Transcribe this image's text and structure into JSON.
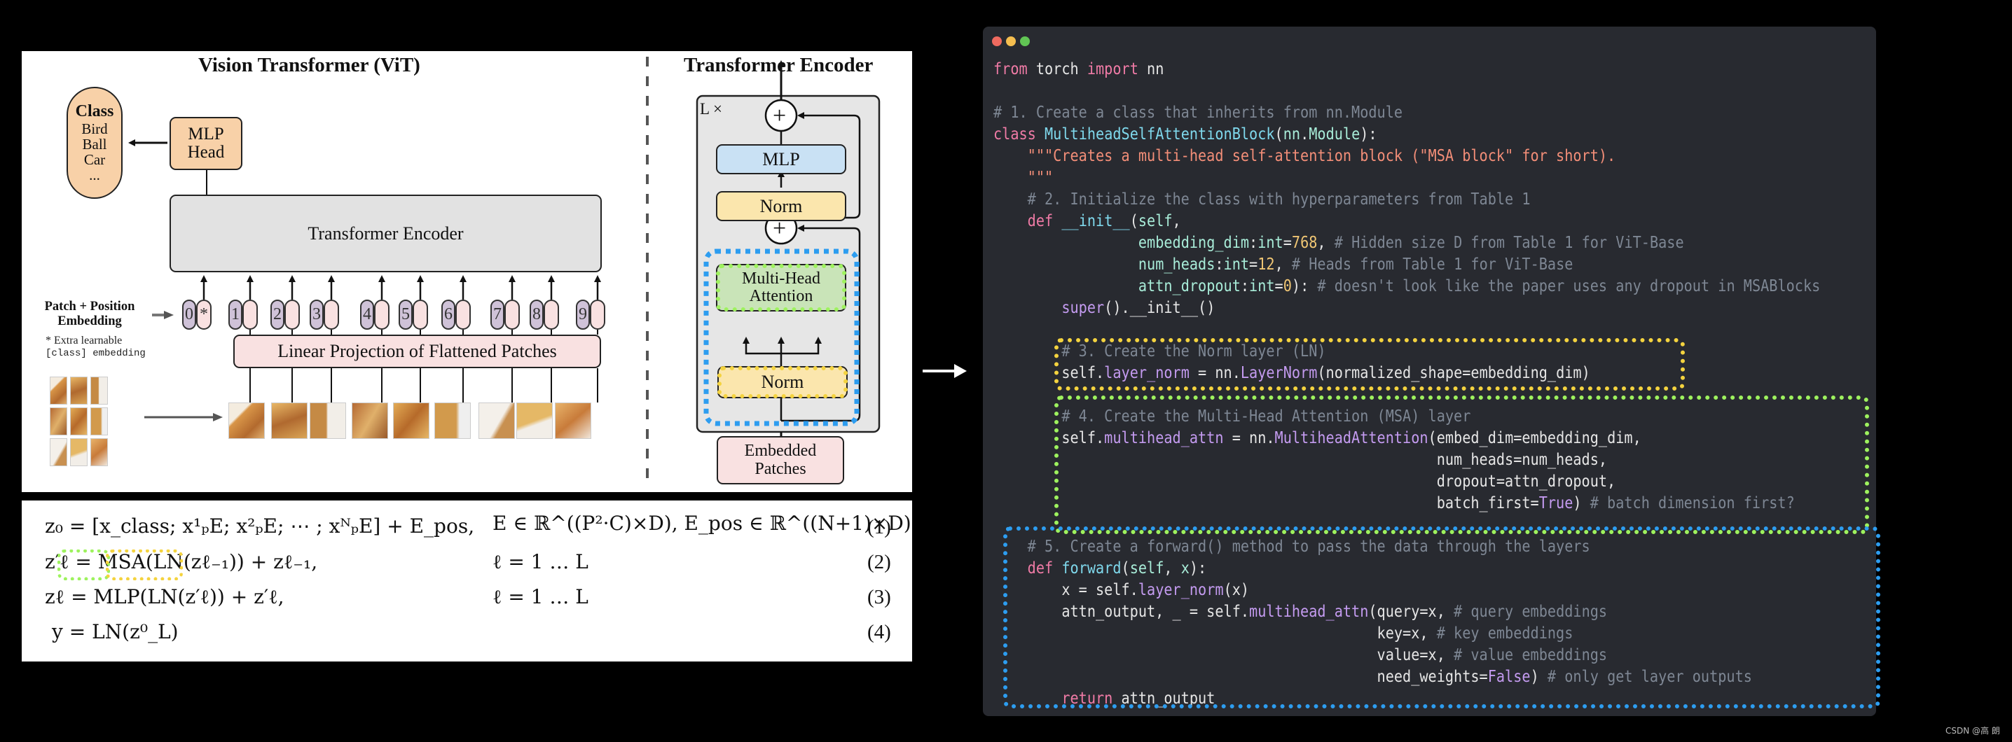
{
  "diagram": {
    "vit_title": "Vision Transformer (ViT)",
    "encoder_title": "Transformer Encoder",
    "class_box": {
      "heading": "Class",
      "items": [
        "Bird",
        "Ball",
        "Car",
        "..."
      ]
    },
    "mlp_head": [
      "MLP",
      "Head"
    ],
    "transformer_encoder_label": "Transformer Encoder",
    "patch_position_label": [
      "Patch + Position",
      "Embedding"
    ],
    "extra_note": [
      "* Extra learnable",
      "[class] embedding"
    ],
    "position_tokens": [
      "0",
      "1",
      "2",
      "3",
      "4",
      "5",
      "6",
      "7",
      "8",
      "9"
    ],
    "class_token_mark": "*",
    "linear_projection_label": "Linear Projection of Flattened Patches",
    "encoder_block": {
      "repeat_label": "L ×",
      "mlp": "MLP",
      "norm_top": "Norm",
      "attention": [
        "Multi-Head",
        "Attention"
      ],
      "norm_bottom": "Norm",
      "embedded_patches": [
        "Embedded",
        "Patches"
      ],
      "plus": "+"
    },
    "colors": {
      "msa_highlight": "#9ef25e",
      "norm_highlight": "#f4d33f",
      "block_highlight": "#2d9df0"
    }
  },
  "equations": {
    "rows": [
      {
        "lhs": "z₀ = [x_class; x¹ₚE; x²ₚE; ⋯ ; xᴺₚE] + E_pos,",
        "rhs": "E ∈ ℝ^((P²·C)×D), E_pos ∈ ℝ^((N+1)×D)",
        "num": "(1)"
      },
      {
        "lhs": "z′ℓ = MSA(LN(zℓ₋₁)) + zℓ₋₁,",
        "rhs": "ℓ = 1 … L",
        "num": "(2)"
      },
      {
        "lhs": "zℓ = MLP(LN(z′ℓ)) + z′ℓ,",
        "rhs": "ℓ = 1 … L",
        "num": "(3)"
      },
      {
        "lhs": "y = LN(z⁰_L)",
        "rhs": "",
        "num": "(4)"
      }
    ]
  },
  "code": {
    "window_dots": [
      "#ee6a5f",
      "#f5be4f",
      "#61c554"
    ],
    "lines": [
      "from torch import nn",
      "",
      "# 1. Create a class that inherits from nn.Module",
      "class MultiheadSelfAttentionBlock(nn.Module):",
      "    \"\"\"Creates a multi-head self-attention block (\"MSA block\" for short).",
      "    \"\"\"",
      "    # 2. Initialize the class with hyperparameters from Table 1",
      "    def __init__(self,",
      "                 embedding_dim:int=768, # Hidden size D from Table 1 for ViT-Base",
      "                 num_heads:int=12, # Heads from Table 1 for ViT-Base",
      "                 attn_dropout:int=0): # doesn't look like the paper uses any dropout in MSABlocks",
      "        super().__init__()",
      "",
      "        # 3. Create the Norm layer (LN)",
      "        self.layer_norm = nn.LayerNorm(normalized_shape=embedding_dim)",
      "",
      "        # 4. Create the Multi-Head Attention (MSA) layer",
      "        self.multihead_attn = nn.MultiheadAttention(embed_dim=embedding_dim,",
      "                                                    num_heads=num_heads,",
      "                                                    dropout=attn_dropout,",
      "                                                    batch_first=True) # batch dimension first?",
      "",
      "    # 5. Create a forward() method to pass the data through the layers",
      "    def forward(self, x):",
      "        x = self.layer_norm(x)",
      "        attn_output, _ = self.multihead_attn(query=x, # query embeddings",
      "                                             key=x, # key embeddings",
      "                                             value=x, # value embeddings",
      "                                             need_weights=False) # only get layer outputs",
      "        return attn_output"
    ]
  },
  "watermark": "CSDN @高 朗"
}
